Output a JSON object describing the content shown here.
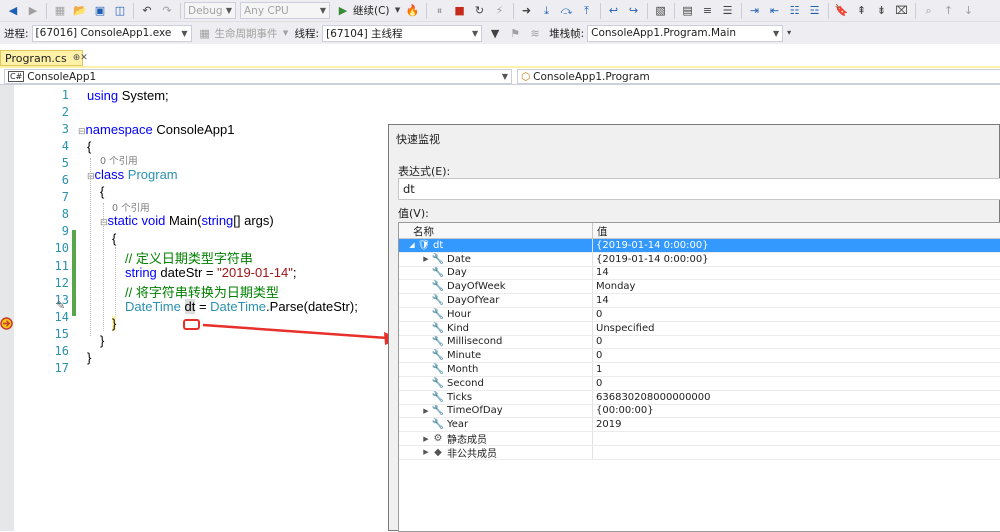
{
  "toolbar": {
    "config": "Debug",
    "platform": "Any CPU",
    "continue_label": "继续(C)"
  },
  "debugbar": {
    "process_label": "进程:",
    "process_value": "[67016] ConsoleApp1.exe",
    "lifecycle_label": "生命周期事件",
    "thread_label": "线程:",
    "thread_value": "[67104] 主线程",
    "stack_label": "堆栈帧:",
    "stack_value": "ConsoleApp1.Program.Main"
  },
  "editor": {
    "tab_name": "Program.cs",
    "tab_pin": "⊕",
    "tab_close": "✕",
    "nav_project": "ConsoleApp1",
    "nav_class": "ConsoleApp1.Program",
    "line_numbers": [
      "1",
      "2",
      "3",
      "4",
      "5",
      "6",
      "7",
      "8",
      "9",
      "10",
      "11",
      "12",
      "13",
      "14",
      "15",
      "16",
      "17"
    ],
    "refs_zero": "0 个引用",
    "code": {
      "l1_kw": "using",
      "l1_rest": " System;",
      "l3_kw": "namespace",
      "l3_rest": " ConsoleApp1",
      "open_brace": "{",
      "close_brace": "}",
      "l5_kw": "class",
      "l5_ty": " Program",
      "l7_kw": "static void",
      "l7_name": " Main(",
      "l7_kw2": "string",
      "l7_rest": "[] args)",
      "l9_cm": "// 定义日期类型字符串",
      "l10_kw": "string",
      "l10_mid": " dateStr = ",
      "l10_str": "\"2019-01-14\"",
      "l10_end": ";",
      "l11_cm": "// 将字符串转换为日期类型",
      "l12_ty": "DateTime",
      "l12_var": "dt",
      "l12_eq": " = ",
      "l12_ty2": "DateTime",
      "l12_rest": ".Parse(dateStr);"
    }
  },
  "quickwatch": {
    "title": "快速监视",
    "expr_label": "表达式(E):",
    "expr_value": "dt",
    "value_label": "值(V):",
    "col_name": "名称",
    "col_value": "值",
    "rows": [
      {
        "name": "dt",
        "value": "{2019-01-14 0:00:00}",
        "indent": 0,
        "toggle": "◢",
        "icon": "🛡",
        "selected": true
      },
      {
        "name": "Date",
        "value": "{2019-01-14 0:00:00}",
        "indent": 1,
        "toggle": "▶",
        "icon": "🔧",
        "selected": false
      },
      {
        "name": "Day",
        "value": "14",
        "indent": 1,
        "toggle": "",
        "icon": "🔧",
        "selected": false
      },
      {
        "name": "DayOfWeek",
        "value": "Monday",
        "indent": 1,
        "toggle": "",
        "icon": "🔧",
        "selected": false
      },
      {
        "name": "DayOfYear",
        "value": "14",
        "indent": 1,
        "toggle": "",
        "icon": "🔧",
        "selected": false
      },
      {
        "name": "Hour",
        "value": "0",
        "indent": 1,
        "toggle": "",
        "icon": "🔧",
        "selected": false
      },
      {
        "name": "Kind",
        "value": "Unspecified",
        "indent": 1,
        "toggle": "",
        "icon": "🔧",
        "selected": false
      },
      {
        "name": "Millisecond",
        "value": "0",
        "indent": 1,
        "toggle": "",
        "icon": "🔧",
        "selected": false
      },
      {
        "name": "Minute",
        "value": "0",
        "indent": 1,
        "toggle": "",
        "icon": "🔧",
        "selected": false
      },
      {
        "name": "Month",
        "value": "1",
        "indent": 1,
        "toggle": "",
        "icon": "🔧",
        "selected": false
      },
      {
        "name": "Second",
        "value": "0",
        "indent": 1,
        "toggle": "",
        "icon": "🔧",
        "selected": false
      },
      {
        "name": "Ticks",
        "value": "636830208000000000",
        "indent": 1,
        "toggle": "",
        "icon": "🔧",
        "selected": false
      },
      {
        "name": "TimeOfDay",
        "value": "{00:00:00}",
        "indent": 1,
        "toggle": "▶",
        "icon": "🔧",
        "selected": false
      },
      {
        "name": "Year",
        "value": "2019",
        "indent": 1,
        "toggle": "",
        "icon": "🔧",
        "selected": false
      },
      {
        "name": "静态成员",
        "value": "",
        "indent": 1,
        "toggle": "▶",
        "icon": "⚙",
        "selected": false
      },
      {
        "name": "非公共成员",
        "value": "",
        "indent": 1,
        "toggle": "▶",
        "icon": "◆",
        "selected": false
      }
    ]
  },
  "colors": {
    "accent": "#3399ff",
    "annotation": "#e8302a",
    "breakpoint_arrow": "#f5c419"
  }
}
